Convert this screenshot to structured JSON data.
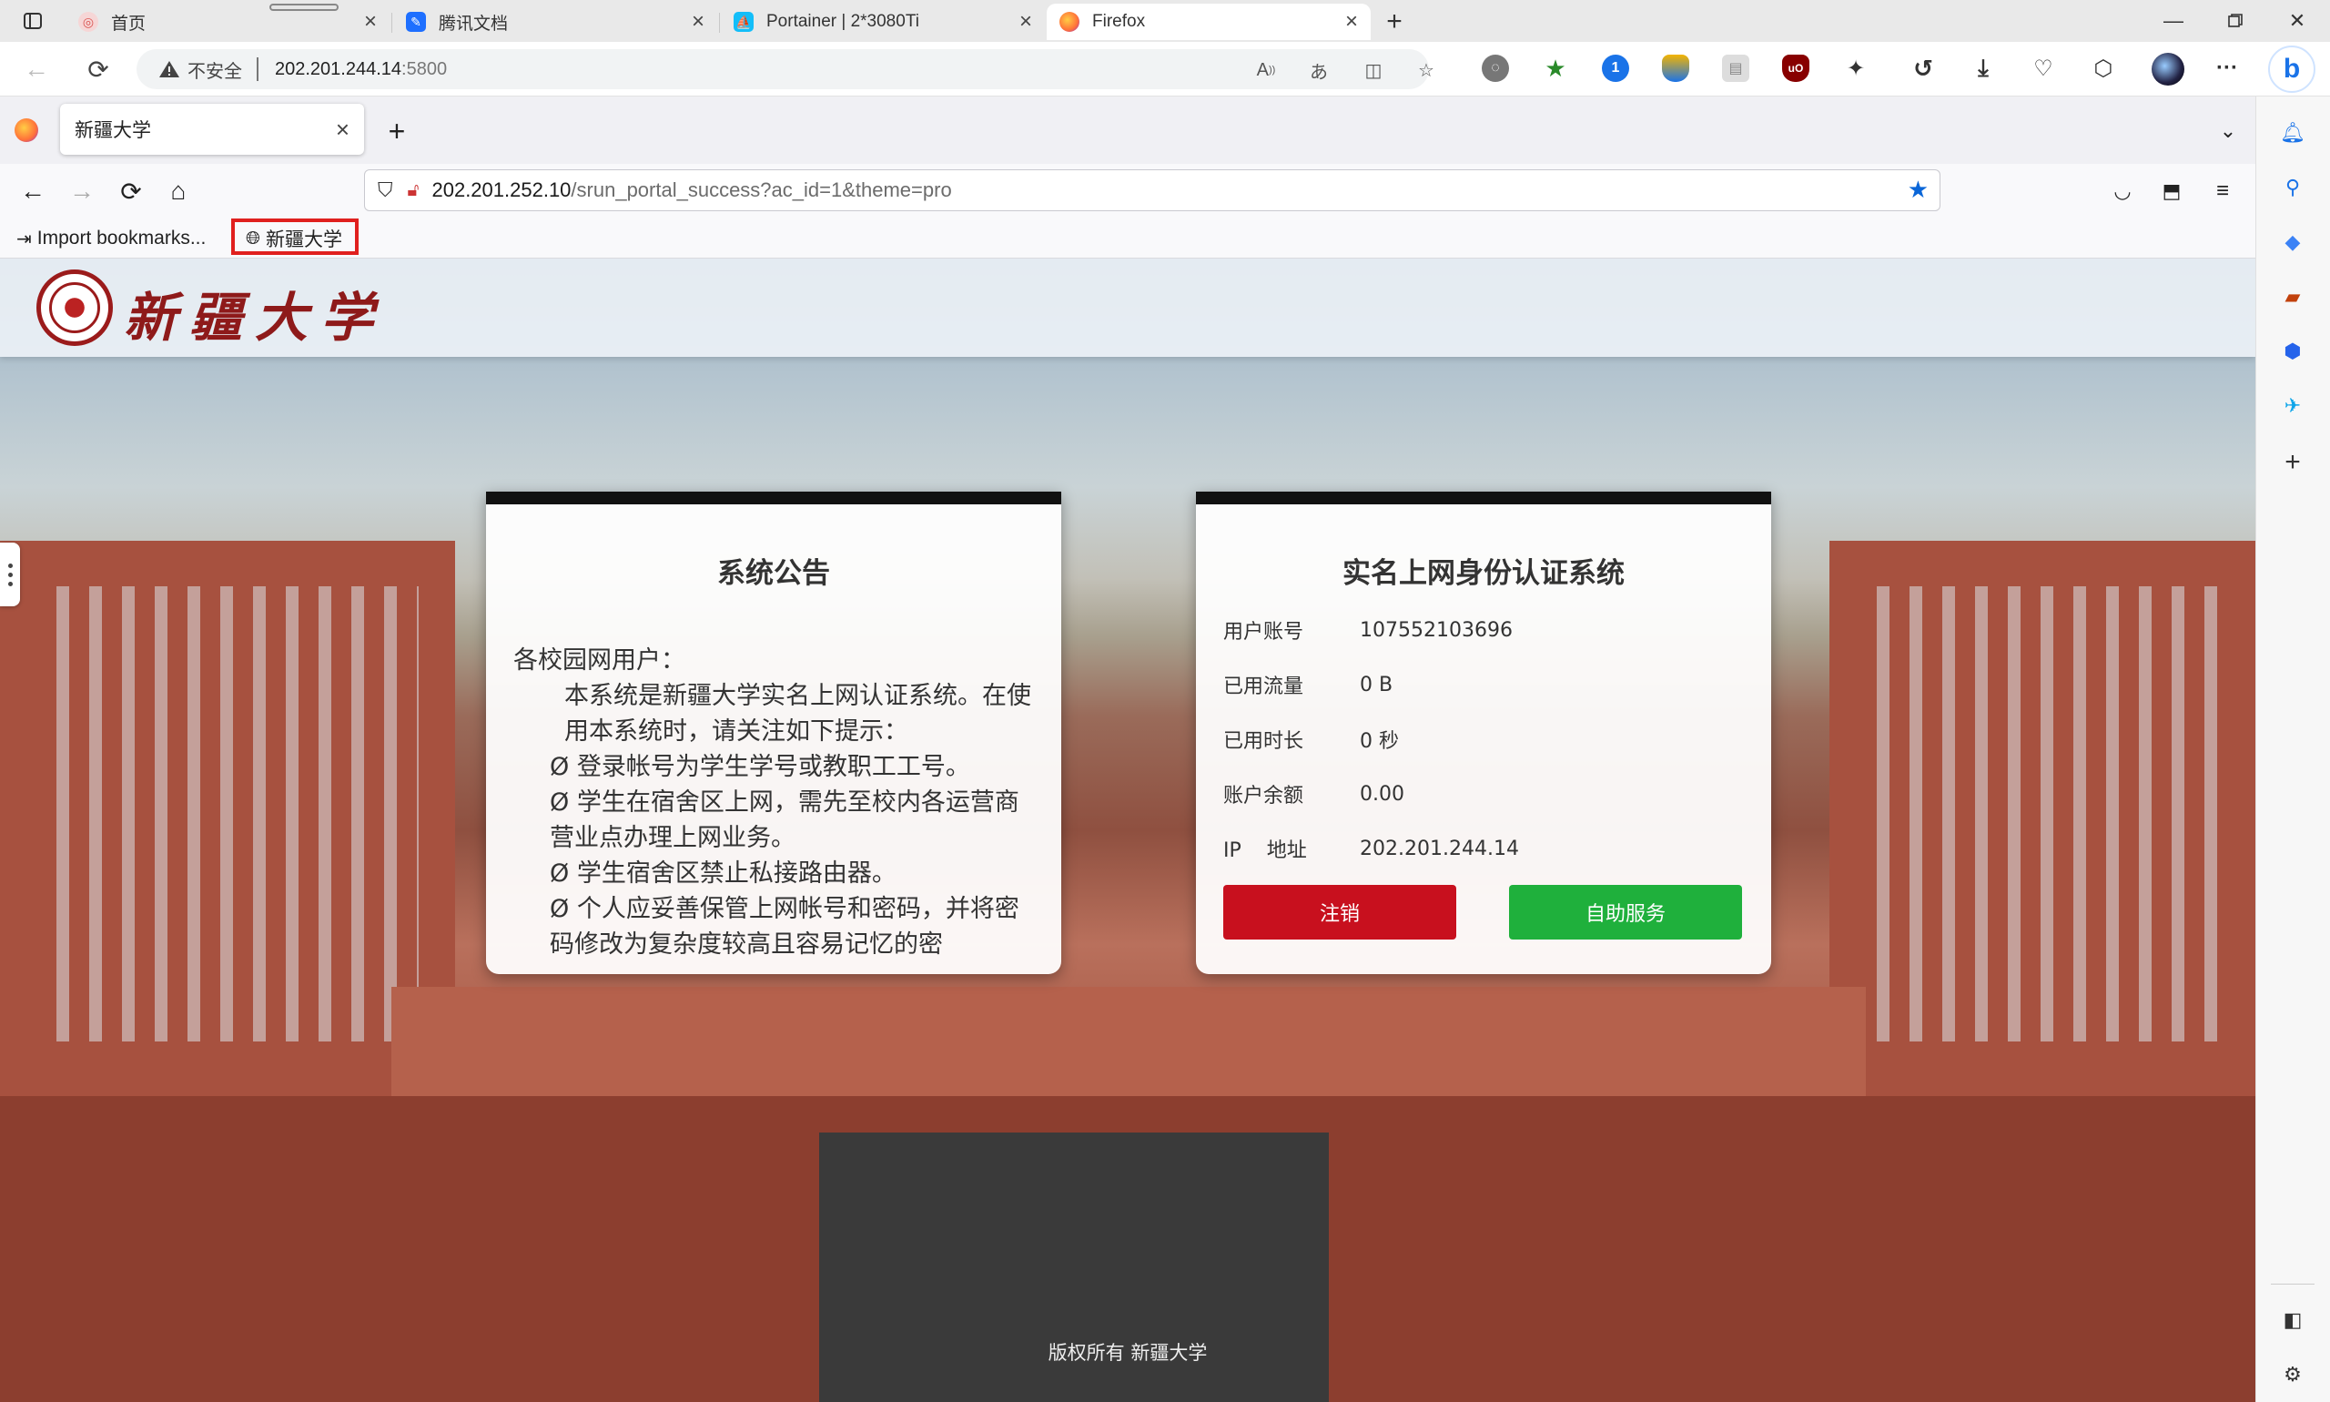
{
  "edge": {
    "tabs": [
      {
        "label": "首页",
        "color": "#d9534f"
      },
      {
        "label": "腾讯文档",
        "color": "#1e6fff"
      },
      {
        "label": "Portainer | 2*3080Ti",
        "color": "#13bef9"
      },
      {
        "label": "Firefox",
        "color": "#ff7139"
      }
    ],
    "address": {
      "security_label": "不安全",
      "host": "202.201.244.14",
      "port": ":5800"
    }
  },
  "firefox": {
    "tab_title": "新疆大学",
    "url_host": "202.201.252.10",
    "url_path": "/srun_portal_success?ac_id=1&theme=pro",
    "bookmarks": {
      "import": "Import bookmarks...",
      "site": "新疆大学"
    }
  },
  "page": {
    "logo_text": "新疆大学",
    "notice": {
      "title": "系统公告",
      "greeting": "各校园网用户：",
      "lines": [
        "本系统是新疆大学实名上网认证系统。在使用本系统时，请关注如下提示：",
        "Ø 登录帐号为学生学号或教职工工号。",
        "Ø 学生在宿舍区上网，需先至校内各运营商营业点办理上网业务。",
        "Ø 学生宿舍区禁止私接路由器。",
        "Ø 个人应妥善保管上网帐号和密码，并将密码修改为复杂度较高且容易记忆的密"
      ]
    },
    "auth": {
      "title": "实名上网身份认证系统",
      "rows": [
        {
          "label": "用户账号",
          "value": "107552103696"
        },
        {
          "label": "已用流量",
          "value": "0 B"
        },
        {
          "label": "已用时长",
          "value": "0 秒"
        },
        {
          "label": "账户余额",
          "value": "0.00"
        },
        {
          "label": "IP    地址",
          "value": "202.201.244.14"
        }
      ],
      "logout_label": "注销",
      "self_service_label": "自助服务",
      "logout_color": "#c8101e",
      "self_service_color": "#1fb03c"
    },
    "footer": "版权所有  新疆大学"
  }
}
